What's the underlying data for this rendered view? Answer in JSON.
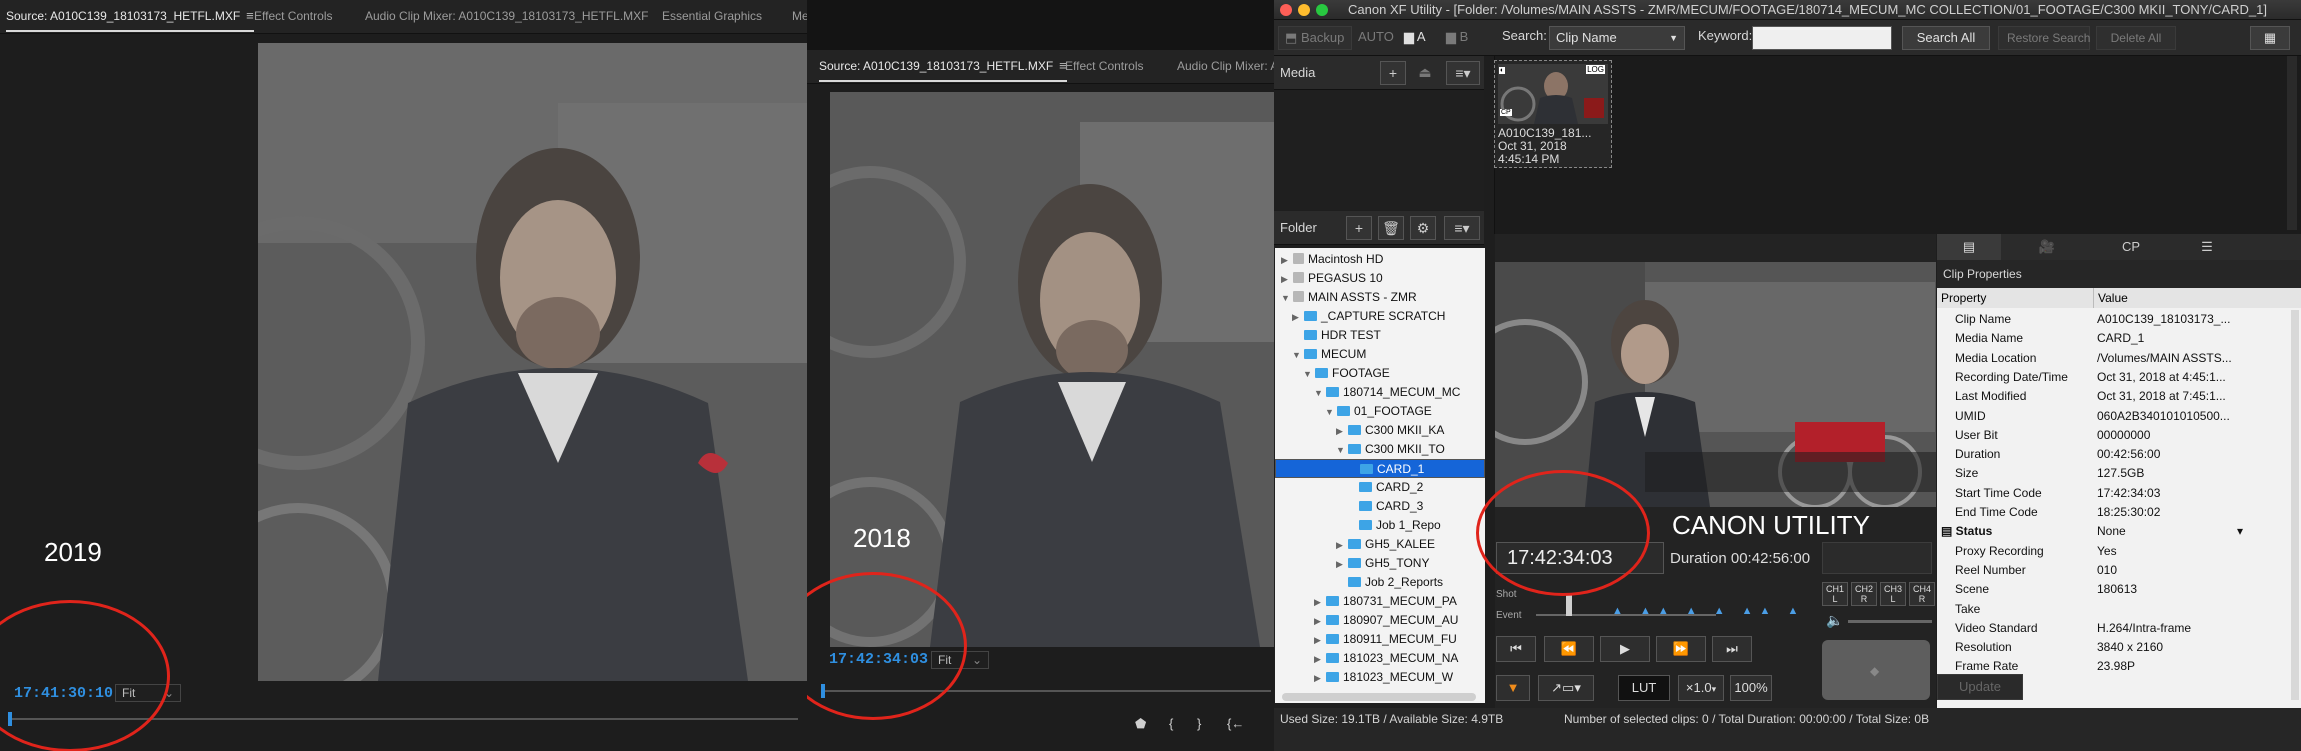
{
  "premiere_2019": {
    "tabs": [
      "Source: A010C139_18103173_HETFL.MXF",
      "Effect Controls",
      "Audio Clip Mixer: A010C139_18103173_HETFL.MXF",
      "Essential Graphics",
      "Me"
    ],
    "menu_icon": "hamburger-icon",
    "year_label": "2019",
    "timecode": "17:41:30:10",
    "fit": "Fit"
  },
  "premiere_2018": {
    "tabs": [
      "Source: A010C139_18103173_HETFL.MXF",
      "Effect Controls",
      "Audio Clip Mixer: A"
    ],
    "year_label": "2018",
    "timecode": "17:42:34:03",
    "fit": "Fit",
    "transport_icons": [
      "marker-icon",
      "in-point-icon",
      "out-point-icon",
      "go-to-in-icon"
    ]
  },
  "canon": {
    "title": "Canon XF Utility - [Folder: /Volumes/MAIN ASSTS - ZMR/MECUM/FOOTAGE/180714_MECUM_MC COLLECTION/01_FOOTAGE/C300 MKII_TONY/CARD_1]",
    "toolbar": {
      "backup": "Backup",
      "auto": "AUTO",
      "a_label": "A",
      "b_label": "B",
      "search_label": "Search:",
      "search_field": "Clip Name",
      "keyword_label": "Keyword:",
      "search_all": "Search All",
      "restore_search": "Restore Search",
      "delete_all": "Delete All"
    },
    "media_header": "Media",
    "folder_header": "Folder",
    "tree": [
      {
        "label": "Macintosh HD",
        "depth": 0,
        "arrow": "▶",
        "drive": true
      },
      {
        "label": "PEGASUS 10",
        "depth": 0,
        "arrow": "▶",
        "drive": true
      },
      {
        "label": "MAIN ASSTS - ZMR",
        "depth": 0,
        "arrow": "▼",
        "drive": true
      },
      {
        "label": "_CAPTURE SCRATCH",
        "depth": 1,
        "arrow": "▶"
      },
      {
        "label": "HDR TEST",
        "depth": 1,
        "arrow": ""
      },
      {
        "label": "MECUM",
        "depth": 1,
        "arrow": "▼"
      },
      {
        "label": "FOOTAGE",
        "depth": 2,
        "arrow": "▼"
      },
      {
        "label": "180714_MECUM_MC",
        "depth": 3,
        "arrow": "▼"
      },
      {
        "label": "01_FOOTAGE",
        "depth": 4,
        "arrow": "▼"
      },
      {
        "label": "C300 MKII_KA",
        "depth": 5,
        "arrow": "▶"
      },
      {
        "label": "C300 MKII_TO",
        "depth": 5,
        "arrow": "▼"
      },
      {
        "label": "CARD_1",
        "depth": 6,
        "arrow": "",
        "selected": true
      },
      {
        "label": "CARD_2",
        "depth": 6,
        "arrow": ""
      },
      {
        "label": "CARD_3",
        "depth": 6,
        "arrow": ""
      },
      {
        "label": "Job 1_Repo",
        "depth": 6,
        "arrow": ""
      },
      {
        "label": "GH5_KALEE",
        "depth": 5,
        "arrow": "▶"
      },
      {
        "label": "GH5_TONY",
        "depth": 5,
        "arrow": "▶"
      },
      {
        "label": "Job 2_Reports",
        "depth": 5,
        "arrow": ""
      },
      {
        "label": "180731_MECUM_PA",
        "depth": 3,
        "arrow": "▶"
      },
      {
        "label": "180907_MECUM_AU",
        "depth": 3,
        "arrow": "▶"
      },
      {
        "label": "180911_MECUM_FU",
        "depth": 3,
        "arrow": "▶"
      },
      {
        "label": "181023_MECUM_NA",
        "depth": 3,
        "arrow": "▶"
      },
      {
        "label": "181023_MECUM_W",
        "depth": 3,
        "arrow": "▶"
      }
    ],
    "thumbnail": {
      "name": "A010C139_181...",
      "date": "Oct 31, 2018",
      "time": "4:45:14 PM",
      "badge_log": "LOG",
      "badge_cp": "CP"
    },
    "preview_title": "CANON UTILITY",
    "timecode": "17:42:34:03",
    "duration_label": "Duration",
    "duration": "00:42:56:00",
    "shot_label": "Shot",
    "event_label": "Event",
    "channels": [
      "CH1\nL",
      "CH2\nR",
      "CH3\nL",
      "CH4\nR"
    ],
    "lut": "LUT",
    "speed": "×1.0",
    "zoom": "100%",
    "props_title": "Clip Properties",
    "props_header": {
      "property": "Property",
      "value": "Value"
    },
    "properties": [
      {
        "k": "Clip Name",
        "v": "A010C139_18103173_..."
      },
      {
        "k": "Media Name",
        "v": "CARD_1"
      },
      {
        "k": "Media Location",
        "v": "/Volumes/MAIN ASSTS..."
      },
      {
        "k": "Recording Date/Time",
        "v": "Oct 31, 2018 at 4:45:1..."
      },
      {
        "k": "Last Modified",
        "v": "Oct 31, 2018 at 7:45:1..."
      },
      {
        "k": "UMID",
        "v": "060A2B340101010500..."
      },
      {
        "k": "User Bit",
        "v": "00000000"
      },
      {
        "k": "Duration",
        "v": "00:42:56:00"
      },
      {
        "k": "Size",
        "v": "127.5GB"
      },
      {
        "k": "Start Time Code",
        "v": "17:42:34:03"
      },
      {
        "k": "End Time Code",
        "v": "18:25:30:02"
      },
      {
        "k": "Status",
        "v": "None",
        "bold": true
      },
      {
        "k": "Proxy Recording",
        "v": "Yes"
      },
      {
        "k": "Reel Number",
        "v": "010"
      },
      {
        "k": "Scene",
        "v": "180613"
      },
      {
        "k": "Take",
        "v": ""
      },
      {
        "k": "Video Standard",
        "v": "H.264/Intra-frame"
      },
      {
        "k": "Resolution",
        "v": "3840 x 2160"
      },
      {
        "k": "Frame Rate",
        "v": "23.98P"
      }
    ],
    "update_button": "Update",
    "used_size": "Used Size: 19.1TB / Available Size: 4.9TB",
    "selected_summary": "Number of selected clips: 0 / Total Duration: 00:00:00 / Total Size: 0B"
  }
}
